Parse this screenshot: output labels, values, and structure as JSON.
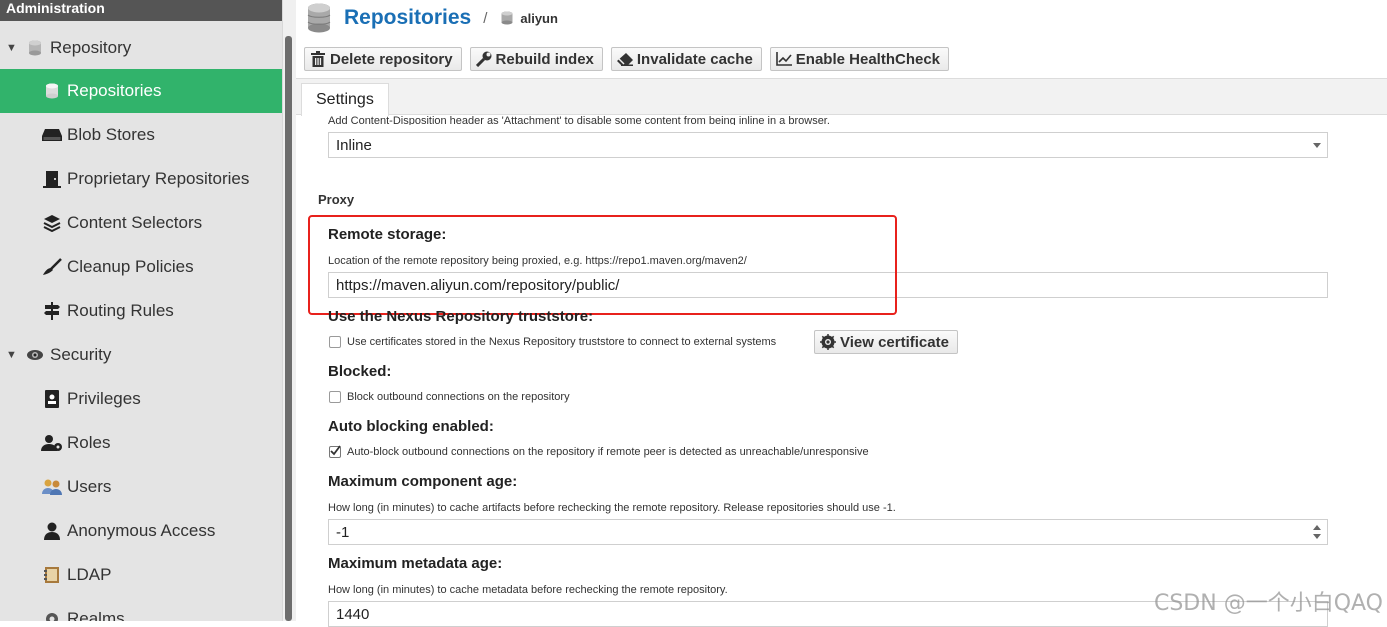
{
  "sidebar": {
    "header": "Administration",
    "rows": [
      {
        "kind": "cat",
        "label": "Repository",
        "icon": "database-icon",
        "active": false
      },
      {
        "kind": "item",
        "label": "Repositories",
        "icon": "database-icon",
        "active": true
      },
      {
        "kind": "item",
        "label": "Blob Stores",
        "icon": "hard-drive-icon",
        "active": false
      },
      {
        "kind": "item",
        "label": "Proprietary Repositories",
        "icon": "door-icon",
        "active": false
      },
      {
        "kind": "item",
        "label": "Content Selectors",
        "icon": "layers-icon",
        "active": false
      },
      {
        "kind": "item",
        "label": "Cleanup Policies",
        "icon": "broom-icon",
        "active": false
      },
      {
        "kind": "item",
        "label": "Routing Rules",
        "icon": "signpost-icon",
        "active": false
      },
      {
        "kind": "cat",
        "label": "Security",
        "icon": "security-icon",
        "active": false
      },
      {
        "kind": "item",
        "label": "Privileges",
        "icon": "id-badge-icon",
        "active": false
      },
      {
        "kind": "item",
        "label": "Roles",
        "icon": "user-roles-icon",
        "active": false
      },
      {
        "kind": "item",
        "label": "Users",
        "icon": "users-icon",
        "active": false
      },
      {
        "kind": "item",
        "label": "Anonymous Access",
        "icon": "user-icon",
        "active": false
      },
      {
        "kind": "item",
        "label": "LDAP",
        "icon": "address-book-icon",
        "active": false
      },
      {
        "kind": "item",
        "label": "Realms",
        "icon": "realms-icon",
        "active": false
      }
    ]
  },
  "header": {
    "title": "Repositories",
    "separator": "/",
    "repo_name": "aliyun"
  },
  "toolbar": {
    "delete_label": "Delete repository",
    "rebuild_label": "Rebuild index",
    "invalidate_label": "Invalidate cache",
    "healthcheck_label": "Enable HealthCheck"
  },
  "tabs": {
    "settings": "Settings"
  },
  "form": {
    "content_disposition_help": "Add Content-Disposition header as 'Attachment' to disable some content from being inline in a browser.",
    "content_disposition_value": "Inline",
    "proxy_section": "Proxy",
    "remote_storage_label": "Remote storage:",
    "remote_storage_help": "Location of the remote repository being proxied, e.g. https://repo1.maven.org/maven2/",
    "remote_storage_value": "https://maven.aliyun.com/repository/public/",
    "truststore_label": "Use the Nexus Repository truststore:",
    "truststore_checkbox_label": "Use certificates stored in the Nexus Repository truststore to connect to external systems",
    "truststore_checked": false,
    "view_certificate_label": "View certificate",
    "blocked_label": "Blocked:",
    "blocked_checkbox_label": "Block outbound connections on the repository",
    "blocked_checked": false,
    "auto_blocking_label": "Auto blocking enabled:",
    "auto_blocking_checkbox_label": "Auto-block outbound connections on the repository if remote peer is detected as unreachable/unresponsive",
    "auto_blocking_checked": true,
    "max_component_age_label": "Maximum component age:",
    "max_component_age_help": "How long (in minutes) to cache artifacts before rechecking the remote repository. Release repositories should use -1.",
    "max_component_age_value": "-1",
    "max_metadata_age_label": "Maximum metadata age:",
    "max_metadata_age_help": "How long (in minutes) to cache metadata before rechecking the remote repository.",
    "max_metadata_age_value": "1440"
  },
  "watermark": "CSDN @一个小白QAQ",
  "colors": {
    "accent_green": "#31b36b",
    "title_blue": "#1a6fb5",
    "highlight_red": "#e8211c",
    "sidebar_bg": "#e4e4e4",
    "sidebar_header_bg": "#555555"
  }
}
